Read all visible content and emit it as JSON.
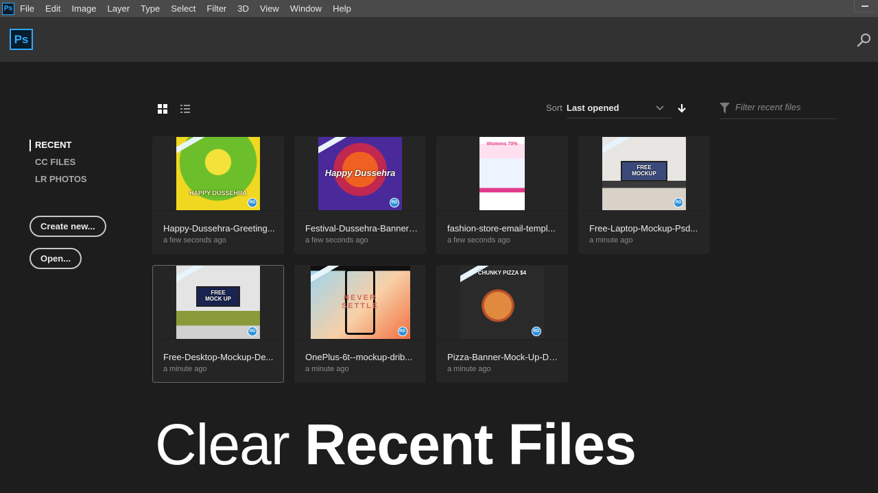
{
  "menubar": {
    "app_icon": "Ps",
    "items": [
      "File",
      "Edit",
      "Image",
      "Layer",
      "Type",
      "Select",
      "Filter",
      "3D",
      "View",
      "Window",
      "Help"
    ]
  },
  "header": {
    "logo": "Ps",
    "search_icon": "search-icon"
  },
  "sidebar": {
    "items": [
      {
        "label": "RECENT",
        "active": true
      },
      {
        "label": "CC FILES",
        "active": false
      },
      {
        "label": "LR PHOTOS",
        "active": false
      }
    ],
    "create_new": "Create new...",
    "open": "Open..."
  },
  "toolbar": {
    "views": [
      "grid-view",
      "list-view"
    ],
    "active_view": "grid-view",
    "sort_label": "Sort",
    "sort_value": "Last opened",
    "sort_direction": "descending",
    "filter_placeholder": "Filter recent files",
    "filter_value": ""
  },
  "files": [
    {
      "title": "Happy-Dussehra-Greeting...",
      "time": "a few seconds ago",
      "thumb_text": "HAPPY DUSSEHRA",
      "badge": "RD"
    },
    {
      "title": "Festival-Dussehra-Banner-...",
      "time": "a few seconds ago",
      "thumb_text": "Happy Dussehra",
      "badge": "RD"
    },
    {
      "title": "fashion-store-email-templ...",
      "time": "a few seconds ago",
      "thumb_text": "Womens 70%",
      "badge": ""
    },
    {
      "title": "Free-Laptop-Mockup-Psd...",
      "time": "a minute ago",
      "thumb_text": "FREE MOCKUP",
      "badge": "RD"
    },
    {
      "title": "Free-Desktop-Mockup-De...",
      "time": "a minute ago",
      "thumb_text": "FREE MOCK UP",
      "badge": "RD",
      "selected": true
    },
    {
      "title": "OnePlus-6t--mockup-drib...",
      "time": "a minute ago",
      "thumb_text": "NEVER SETTLE",
      "badge": "RD"
    },
    {
      "title": "Pizza-Banner-Mock-Up-De...",
      "time": "a minute ago",
      "thumb_text": "CHUNKY PIZZA $4",
      "badge": "RD"
    }
  ],
  "overlay": {
    "light": "Clear",
    "bold": "Recent Files"
  },
  "colors": {
    "accent": "#31a8ff",
    "menubar_bg": "#4a4a4a",
    "header_bg": "#323232",
    "main_bg": "#1d1d1d",
    "card_bg": "#252525"
  }
}
